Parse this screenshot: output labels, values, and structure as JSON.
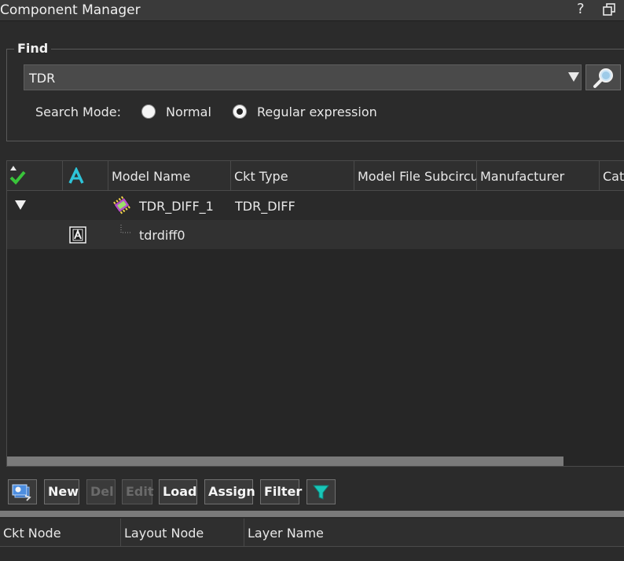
{
  "window": {
    "title": "Component Manager",
    "help_label": "?"
  },
  "find": {
    "legend": "Find",
    "query": "TDR",
    "search_mode_label": "Search Mode:",
    "modes": [
      {
        "label": "Normal",
        "selected": false
      },
      {
        "label": "Regular expression",
        "selected": true
      }
    ]
  },
  "table": {
    "columns": [
      "",
      "",
      "Model Name",
      "Ckt Type",
      "Model File Subcircuit",
      "Manufacturer",
      "Catalog"
    ],
    "rows": [
      {
        "model_name": "TDR_DIFF_1",
        "ckt_type": "TDR_DIFF",
        "expanded": true
      },
      {
        "model_name": "tdrdiff0",
        "ckt_type": ""
      }
    ]
  },
  "toolbar": {
    "new": "New",
    "del": "Del",
    "edit": "Edit",
    "load": "Load",
    "assign": "Assign",
    "filter": "Filter"
  },
  "bottom_table": {
    "columns": [
      "Ckt Node",
      "Layout Node",
      "Layer Name"
    ]
  },
  "colors": {
    "accent_green": "#39c43a",
    "accent_cyan": "#2ec4d9",
    "filter_teal": "#19c6b8"
  }
}
